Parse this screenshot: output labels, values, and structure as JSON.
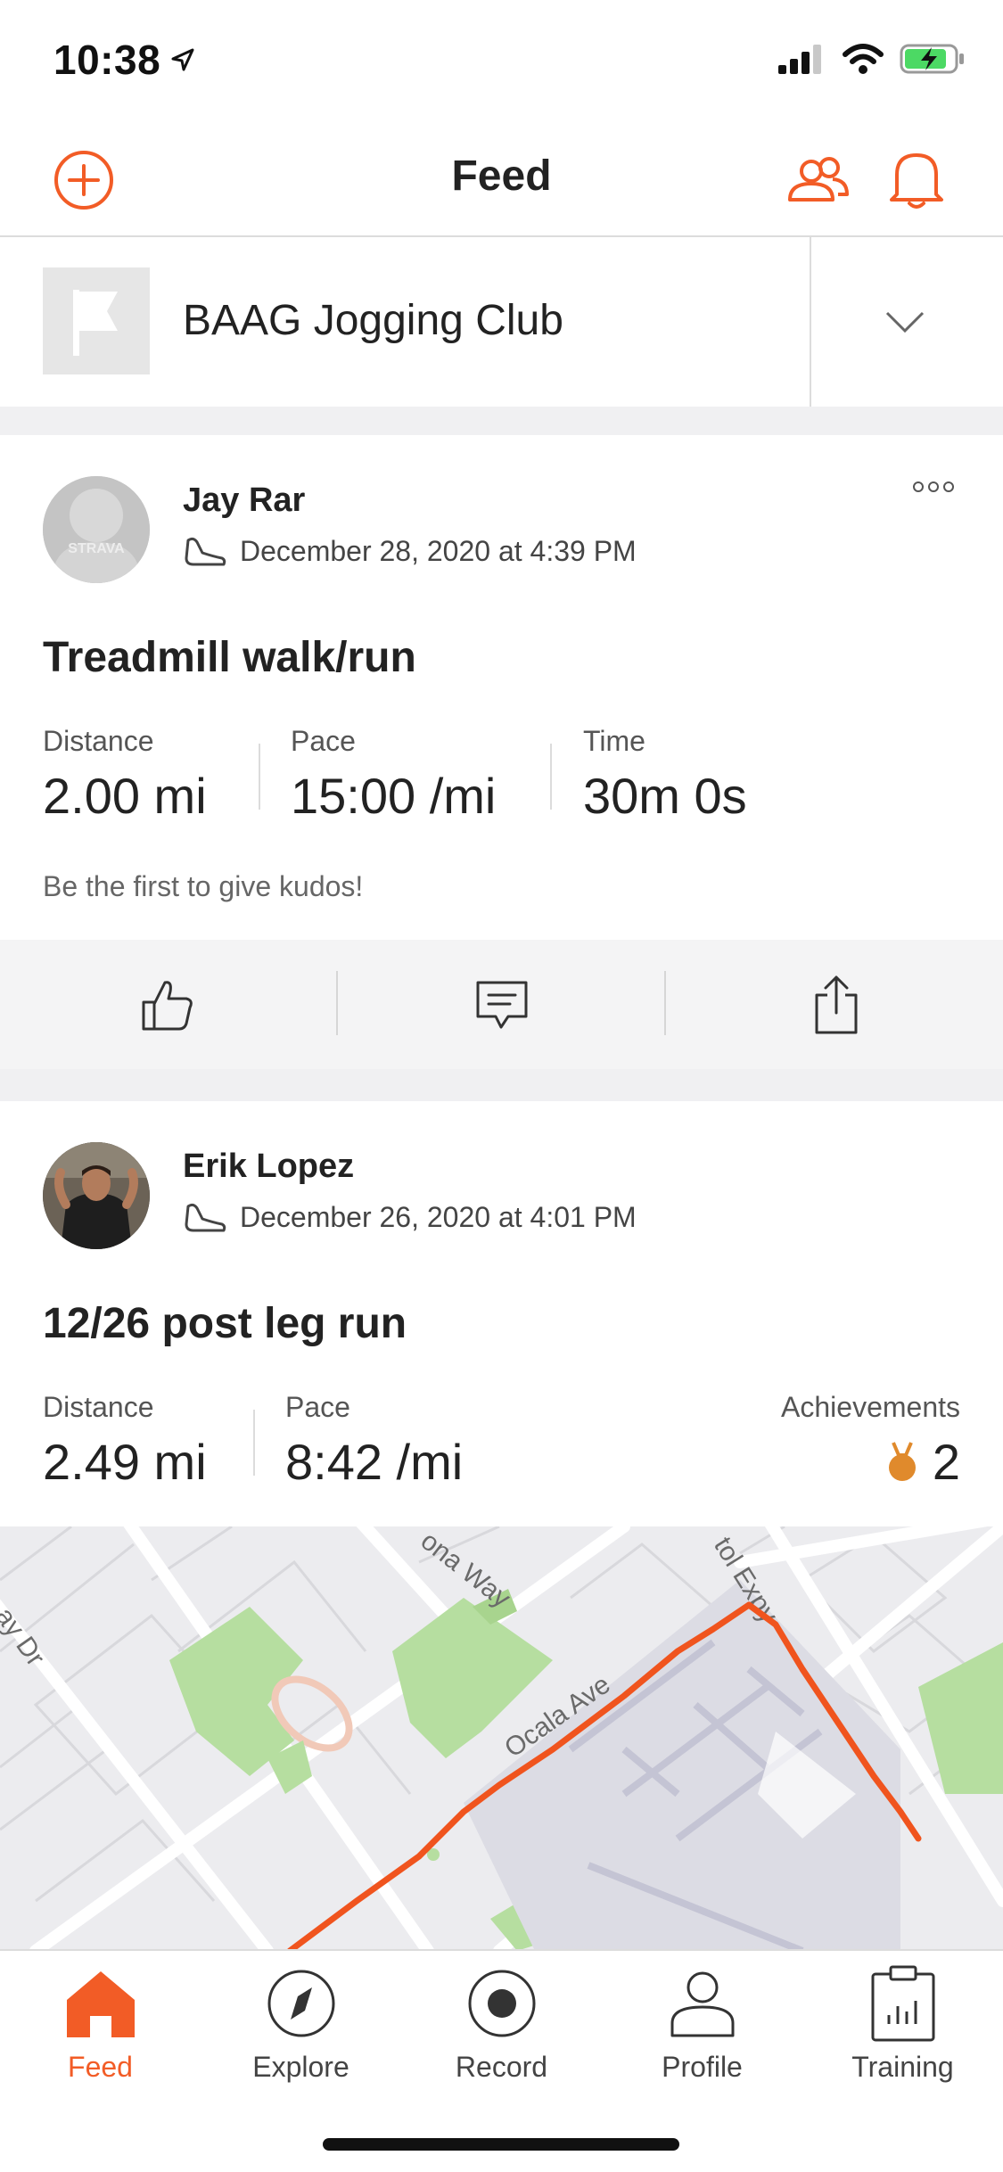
{
  "status_bar": {
    "time": "10:38",
    "location_icon": "location-arrow-icon",
    "signal_icon": "cellular-signal-icon",
    "wifi_icon": "wifi-icon",
    "battery_icon": "battery-charging-icon"
  },
  "header": {
    "title": "Feed",
    "add_icon": "plus-circle-icon",
    "people_icon": "people-icon",
    "bell_icon": "bell-icon"
  },
  "club_selector": {
    "name": "BAAG Jogging Club",
    "logo_icon": "flag-icon",
    "chevron_icon": "chevron-down-icon"
  },
  "posts": [
    {
      "athlete": "Jay Rar",
      "date": "December 28, 2020 at 4:39 PM",
      "avatar_text": "STRAVA",
      "activity_icon": "shoe-icon",
      "title": "Treadmill walk/run",
      "stats": [
        {
          "label": "Distance",
          "value": "2.00 mi"
        },
        {
          "label": "Pace",
          "value": "15:00 /mi"
        },
        {
          "label": "Time",
          "value": "30m 0s"
        }
      ],
      "kudos_text": "Be the first to give kudos!"
    },
    {
      "athlete": "Erik Lopez",
      "date": "December 26, 2020 at 4:01 PM",
      "activity_icon": "shoe-icon",
      "title": "12/26 post leg run",
      "stats": [
        {
          "label": "Distance",
          "value": "2.49 mi"
        },
        {
          "label": "Pace",
          "value": "8:42 /mi"
        }
      ],
      "achievements": {
        "label": "Achievements",
        "count": "2",
        "icon": "medal-icon"
      }
    }
  ],
  "map": {
    "streets": [
      "ona Way",
      "Ocala Ave",
      "tol Expy",
      "ay Dr"
    ]
  },
  "tabs": [
    {
      "label": "Feed",
      "icon": "home-icon",
      "active": true
    },
    {
      "label": "Explore",
      "icon": "compass-icon",
      "active": false
    },
    {
      "label": "Record",
      "icon": "record-icon",
      "active": false
    },
    {
      "label": "Profile",
      "icon": "person-icon",
      "active": false
    },
    {
      "label": "Training",
      "icon": "clipboard-chart-icon",
      "active": false
    }
  ],
  "colors": {
    "accent": "#f25c26",
    "route": "#f0541e",
    "park": "#b6dea0",
    "building": "#d6d6e0"
  }
}
